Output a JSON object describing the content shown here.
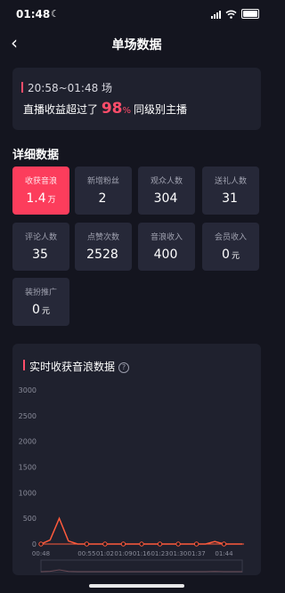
{
  "status": {
    "time": "01:48"
  },
  "nav": {
    "title": "单场数据"
  },
  "summary": {
    "time_range": "20:58~01:48 场",
    "prefix": "直播收益超过了",
    "percent": "98",
    "percent_unit": "%",
    "suffix": "同级别主播"
  },
  "details": {
    "title": "详细数据",
    "tiles": [
      {
        "label": "收获音浪",
        "value": "1.4",
        "unit": "万"
      },
      {
        "label": "新增粉丝",
        "value": "2",
        "unit": ""
      },
      {
        "label": "观众人数",
        "value": "304",
        "unit": ""
      },
      {
        "label": "送礼人数",
        "value": "31",
        "unit": ""
      },
      {
        "label": "评论人数",
        "value": "35",
        "unit": ""
      },
      {
        "label": "点赞次数",
        "value": "2528",
        "unit": ""
      },
      {
        "label": "音浪收入",
        "value": "400",
        "unit": ""
      },
      {
        "label": "会员收入",
        "value": "0",
        "unit": "元"
      },
      {
        "label": "装扮推广",
        "value": "0",
        "unit": "元"
      }
    ]
  },
  "chart_section": {
    "title": "实时收获音浪数据",
    "help": "?"
  },
  "chart_data": {
    "type": "line",
    "x": [
      "00:48",
      "00:49",
      "00:50",
      "00:51",
      "00:52",
      "00:55",
      "00:58",
      "01:02",
      "01:05",
      "01:09",
      "01:13",
      "01:16",
      "01:20",
      "01:23",
      "01:27",
      "01:30",
      "01:34",
      "01:37",
      "01:40",
      "01:42",
      "01:44",
      "01:46",
      "01:48"
    ],
    "values": [
      0,
      80,
      500,
      60,
      0,
      0,
      0,
      0,
      0,
      0,
      0,
      0,
      0,
      0,
      0,
      0,
      0,
      0,
      0,
      50,
      0,
      0,
      0
    ],
    "xticks": [
      "00:48",
      "00:55",
      "01:02",
      "01:09",
      "01:16",
      "01:23",
      "01:30",
      "01:37",
      "01:44"
    ],
    "yticks": [
      "3000",
      "2500",
      "2000",
      "1500",
      "1000",
      "500",
      "0"
    ],
    "ylim": [
      0,
      3000
    ],
    "series_color": "#ff5a3c",
    "grid": false
  },
  "colors": {
    "accent": "#fc3d5c",
    "background": "#14151f",
    "card": "#1f212e"
  }
}
